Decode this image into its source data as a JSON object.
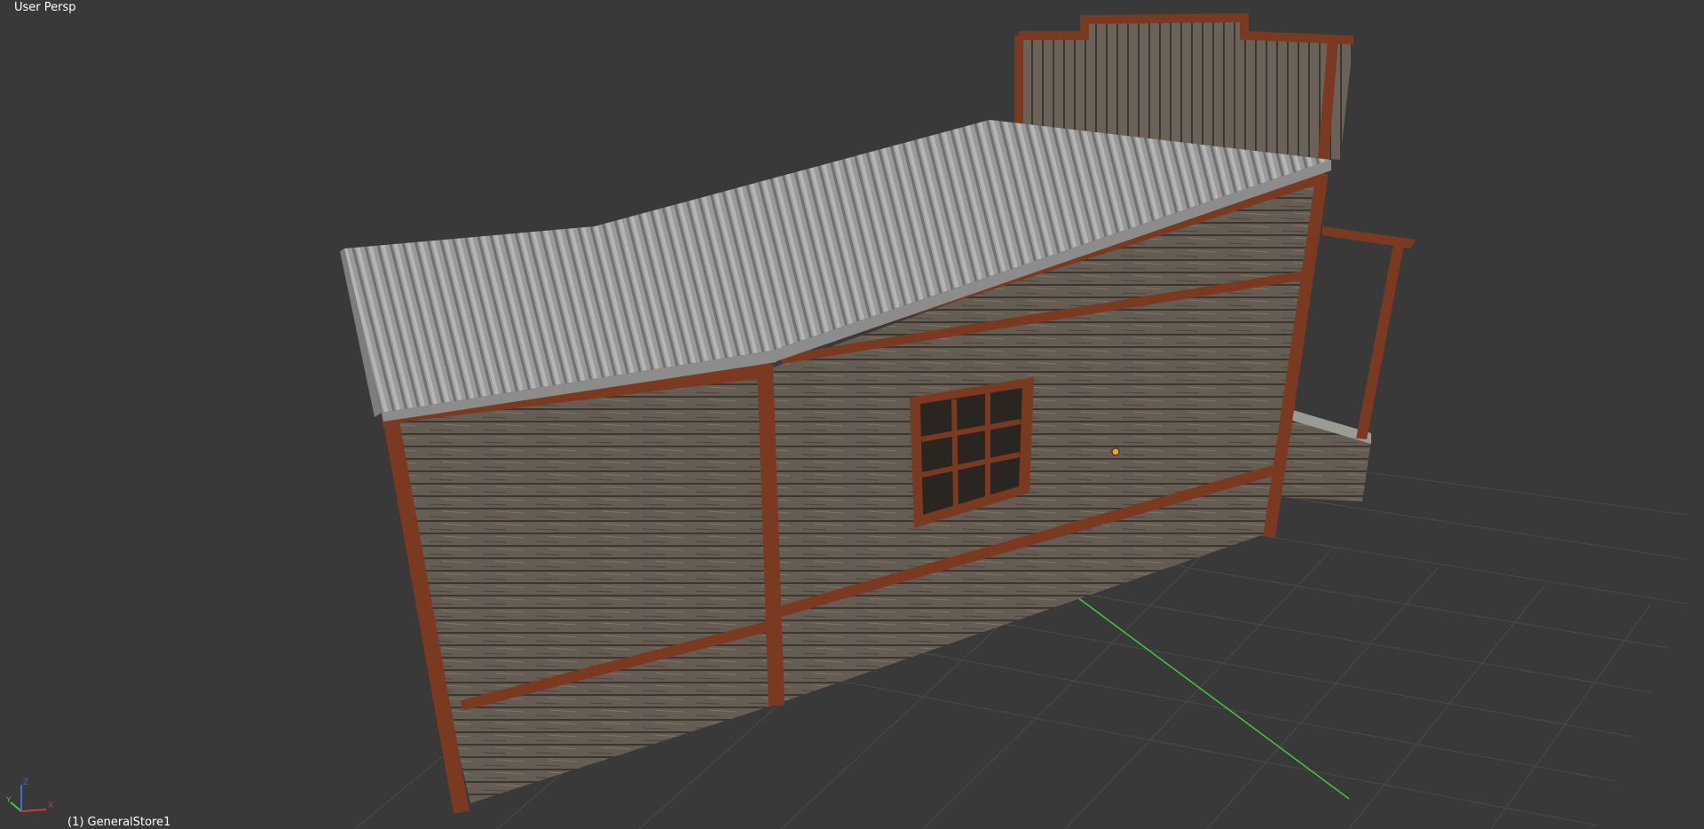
{
  "viewport": {
    "view_name": "User Persp",
    "object_info": "(1) GeneralStore1",
    "background_color": "#393939",
    "grid_color": "#4a4a4a",
    "x_axis_color": "#d23a3a",
    "y_axis_color": "#47c447",
    "z_axis_color": "#3b6fd6"
  },
  "gizmo": {
    "x_label": "X",
    "y_label": "Y",
    "z_label": "Z"
  },
  "model": {
    "name": "GeneralStore1",
    "wood_trim_color": "#7a3a22",
    "wall_color": "#6a6158",
    "roof_color": "#9a9a9a"
  }
}
